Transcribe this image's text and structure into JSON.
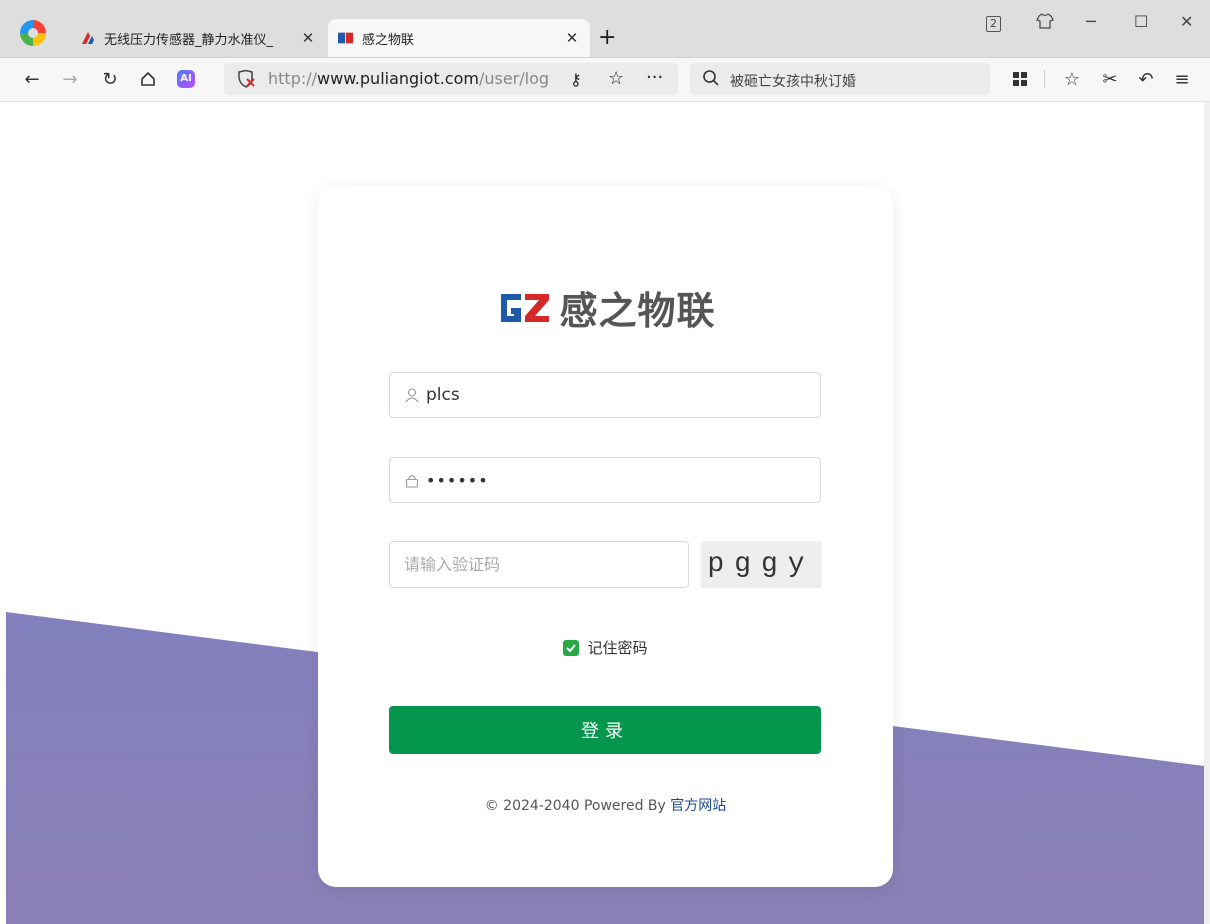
{
  "browser": {
    "tabs": [
      {
        "title": "无线压力传感器_静力水准仪_",
        "active": false
      },
      {
        "title": "感之物联",
        "active": true
      }
    ],
    "tab_count_badge": "2",
    "url_scheme": "http://",
    "url_host": "www.puliangiot.com",
    "url_path": "/user/log",
    "search_text": "被砸亡女孩中秋订婚"
  },
  "login": {
    "brand_name": "感之物联",
    "brand_mark": "GZ",
    "username_value": "plcs",
    "password_value": "••••••",
    "captcha_placeholder": "请输入验证码",
    "captcha_text": "pggy",
    "remember_label": "记住密码",
    "remember_checked": true,
    "submit_label": "登录",
    "footer_text": "© 2024-2040 Powered By ",
    "footer_link": "官方网站"
  },
  "colors": {
    "primary_button": "#05964d",
    "checkbox": "#28a745",
    "wave_top": "#7580cc",
    "wave_bottom": "#8b80b6",
    "brand_blue": "#1f5aa8",
    "brand_red": "#d62828"
  }
}
